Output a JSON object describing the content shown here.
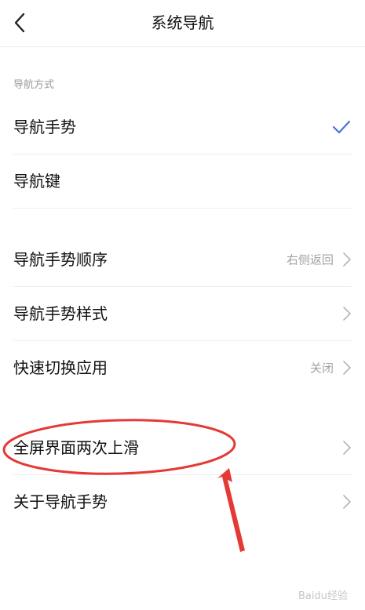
{
  "header": {
    "title": "系统导航",
    "back_icon": "chevron-left-icon"
  },
  "section": {
    "label": "导航方式"
  },
  "rows": [
    {
      "label": "导航手势",
      "selected": true
    },
    {
      "label": "导航键",
      "selected": false
    },
    {
      "label": "导航手势顺序",
      "value": "右侧返回"
    },
    {
      "label": "导航手势样式",
      "value": ""
    },
    {
      "label": "快速切换应用",
      "value": "关闭"
    },
    {
      "label": "全屏界面两次上滑",
      "value": ""
    },
    {
      "label": "关于导航手势",
      "value": ""
    }
  ],
  "colors": {
    "accent": "#4a73d8",
    "annotation": "#e53935",
    "secondary_text": "#a3a3a3"
  },
  "watermark": {
    "text": "Baidu经验"
  }
}
